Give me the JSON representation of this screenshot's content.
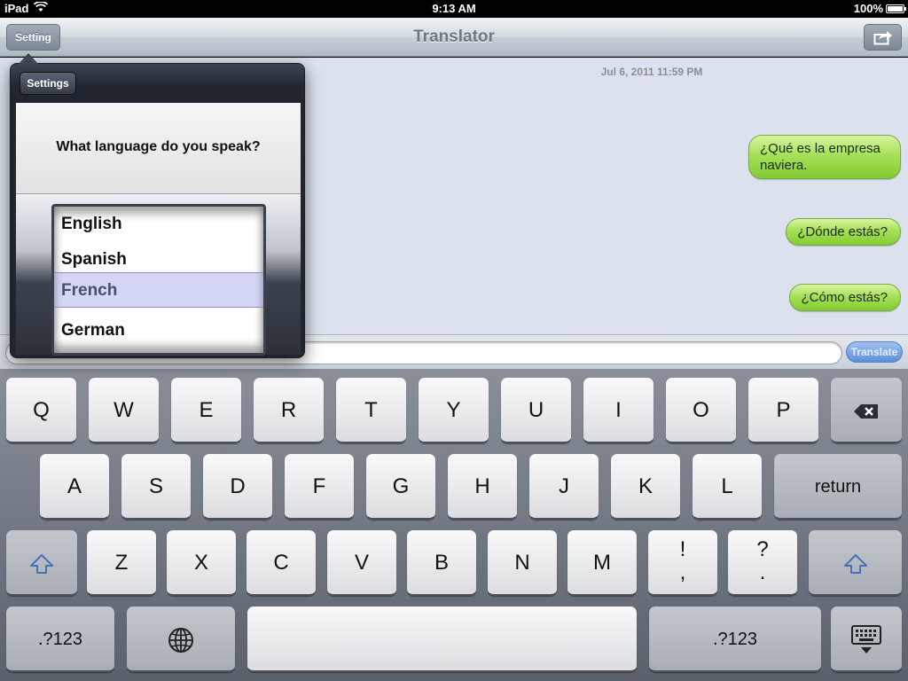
{
  "status_bar": {
    "carrier": "iPad",
    "time": "9:13 AM",
    "battery": "100%",
    "battery_level": 1.0
  },
  "nav": {
    "left_button": "Setting",
    "title": "Translator",
    "share_icon": "share-icon"
  },
  "messages": {
    "timestamp": "Jul 6, 2011 11:59 PM",
    "items": [
      {
        "text": "¿Qué es la empresa naviera."
      },
      {
        "text": "¿Dónde estás?"
      },
      {
        "text": "¿Cómo estás?"
      }
    ]
  },
  "input": {
    "value": "",
    "send_button": "Translate"
  },
  "popover": {
    "button": "Settings",
    "question": "What language do you speak?",
    "options": [
      "English",
      "Spanish",
      "French",
      "German"
    ],
    "selected": "French"
  },
  "keyboard": {
    "row1": [
      "Q",
      "W",
      "E",
      "R",
      "T",
      "Y",
      "U",
      "I",
      "O",
      "P"
    ],
    "row2": [
      "A",
      "S",
      "D",
      "F",
      "G",
      "H",
      "J",
      "K",
      "L"
    ],
    "row3": [
      "Z",
      "X",
      "C",
      "V",
      "B",
      "N",
      "M"
    ],
    "punct1": {
      "top": "!",
      "bottom": ","
    },
    "punct2": {
      "top": "?",
      "bottom": "."
    },
    "return": "return",
    "numbers_left": ".?123",
    "numbers_right": ".?123",
    "icons": [
      "delete-icon",
      "shift-icon",
      "globe-icon",
      "hide-keyboard-icon"
    ]
  }
}
